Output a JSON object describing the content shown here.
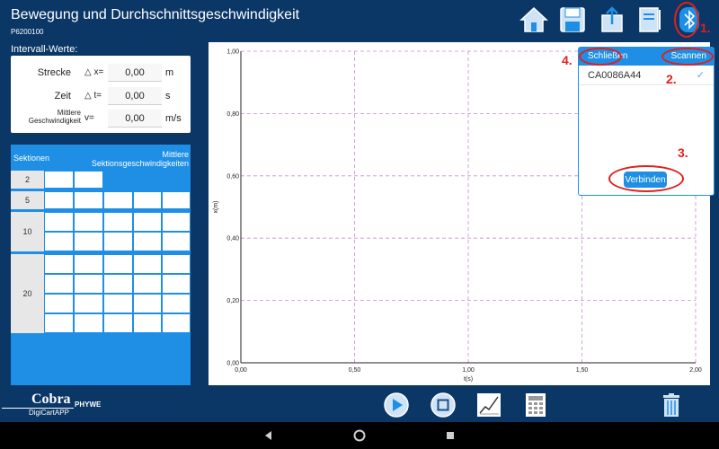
{
  "header": {
    "title": "Bewegung und Durchschnittsgeschwindigkeit",
    "code": "P6200100"
  },
  "toolbar": {
    "icons": [
      "home-icon",
      "save-icon",
      "share-icon",
      "notebook-icon",
      "bluetooth-icon"
    ]
  },
  "intervall": {
    "label": "Intervall-Werte:",
    "rows": [
      {
        "label": "Strecke",
        "symbol": "△ x=",
        "value": "0,00",
        "unit": "m"
      },
      {
        "label": "Zeit",
        "symbol": "△ t=",
        "value": "0,00",
        "unit": "s"
      },
      {
        "label_line1": "Mittlere",
        "label_line2": "Geschwindigkeit",
        "symbol": "v=",
        "value": "0,00",
        "unit": "m/s"
      }
    ]
  },
  "sektionen": {
    "header_left": "Sektionen",
    "header_right_line1": "Mittlere",
    "header_right_line2": "Sektionsgeschwindigkeiten",
    "rows": [
      "2",
      "5",
      "10",
      "20"
    ]
  },
  "chart_data": {
    "type": "line",
    "xlabel": "t(s)",
    "ylabel": "x(m)",
    "xlim": [
      0,
      2
    ],
    "ylim": [
      0,
      1
    ],
    "xticks": [
      "0,00",
      "0,50",
      "1,00",
      "1,50",
      "2,00"
    ],
    "yticks": [
      "0,00",
      "0,20",
      "0,40",
      "0,60",
      "0,80",
      "1,00"
    ],
    "grid": true,
    "series": []
  },
  "bluetooth_popup": {
    "close_label": "Schließen",
    "scan_label": "Scannen",
    "device_name": "CA0086A44",
    "device_check": "✓",
    "connect_label": "Verbinden"
  },
  "annotations": {
    "a1": "1.",
    "a2": "2.",
    "a3": "3.",
    "a4": "4."
  },
  "logo": {
    "name": "Cobra",
    "sub": "DigiCartAPP",
    "brand": "PHYWE"
  },
  "bottom_toolbar": {
    "icons": [
      "play-icon",
      "stop-icon",
      "chart-icon",
      "calculator-icon",
      "trash-icon"
    ]
  },
  "colors": {
    "primary_dark": "#0b3767",
    "accent_blue": "#1f8fe5",
    "annotation_red": "#e0201c",
    "grid": "#c98bd0"
  }
}
